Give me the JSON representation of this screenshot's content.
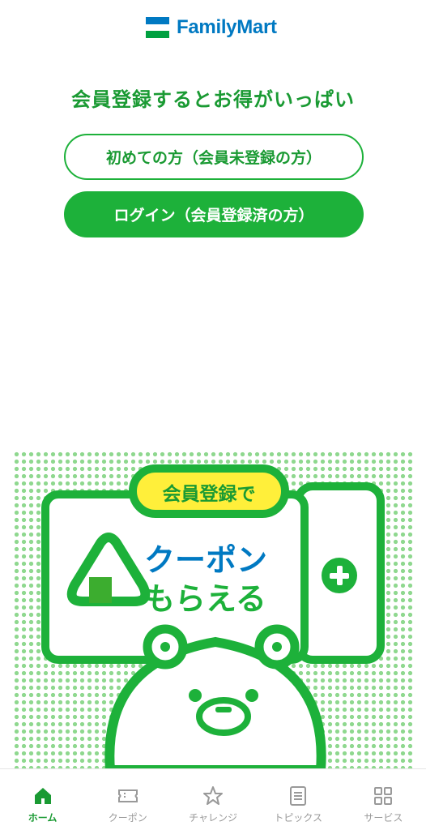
{
  "brand": {
    "name": "FamilyMart",
    "logo_colors": [
      "#00a040",
      "#0079c2"
    ]
  },
  "headline": "会員登録するとお得がいっぱい",
  "buttons": {
    "register": "初めての方（会員未登録の方）",
    "login": "ログイン（会員登録済の方）"
  },
  "banner": {
    "tag": "会員登録で",
    "line1": "クーポン",
    "line2": "もらえる",
    "icons": [
      "onigiri-icon",
      "plus-icon",
      "bear-mascot"
    ]
  },
  "tabs": [
    {
      "label": "ホーム",
      "icon": "home-icon",
      "active": true
    },
    {
      "label": "クーポン",
      "icon": "coupon-icon",
      "active": false
    },
    {
      "label": "チャレンジ",
      "icon": "star-icon",
      "active": false
    },
    {
      "label": "トピックス",
      "icon": "document-icon",
      "active": false
    },
    {
      "label": "サービス",
      "icon": "grid-icon",
      "active": false
    }
  ],
  "colors": {
    "green": "#1db13a",
    "dark_green": "#1a9a33",
    "blue": "#0079c2",
    "yellow": "#ffef3a",
    "inactive": "#999999"
  }
}
